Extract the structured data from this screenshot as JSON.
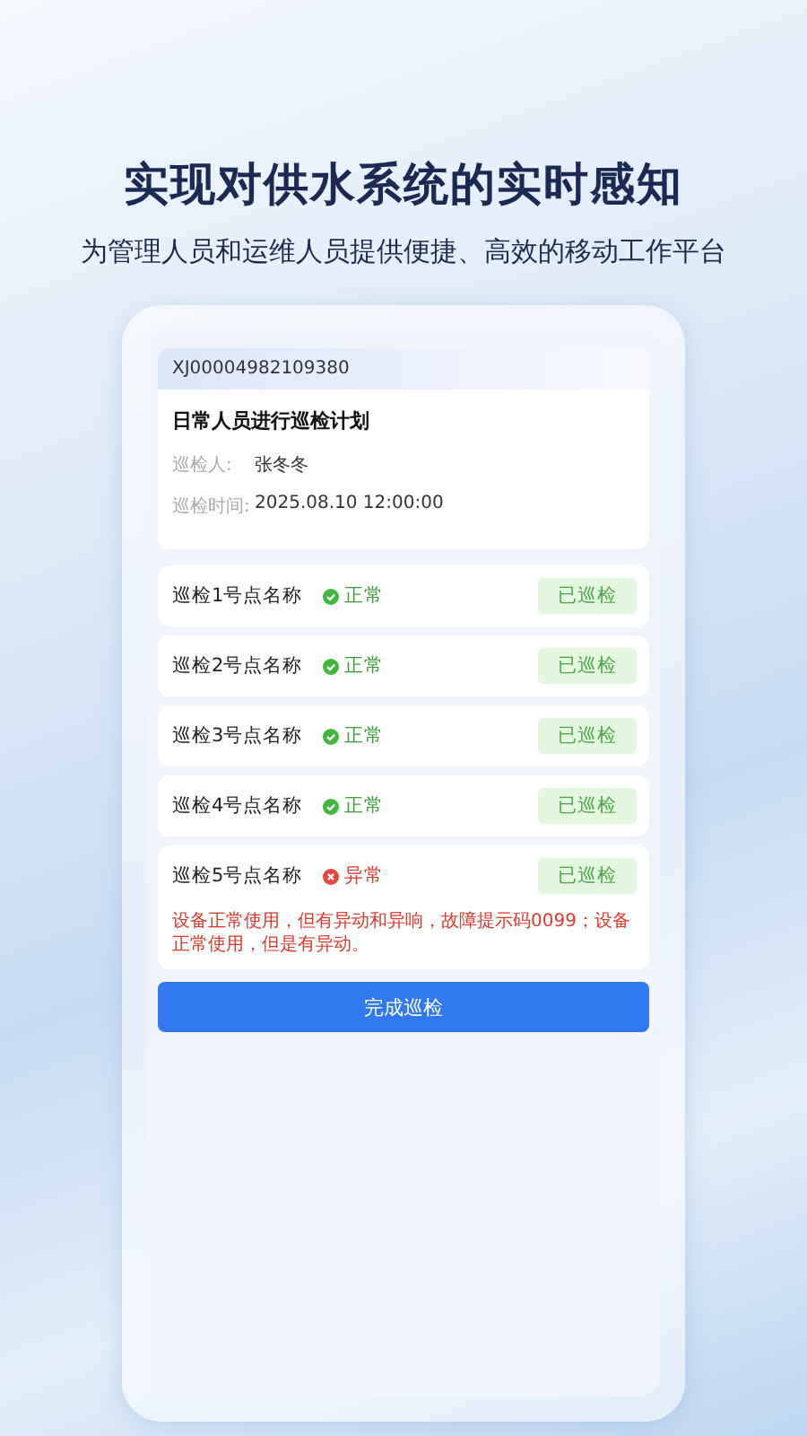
{
  "headline": "实现对供水系统的实时感知",
  "subtitle": "为管理人员和运维人员提供便捷、高效的移动工作平台",
  "task": {
    "code": "XJ00004982109380",
    "title": "日常人员进行巡检计划",
    "fields": [
      {
        "label": "巡检人:",
        "value": "张冬冬"
      },
      {
        "label": "巡检时间:",
        "value": "2025.08.10 12:00:00"
      }
    ]
  },
  "points": [
    {
      "name": "巡检1号点名称",
      "status": "正常",
      "kind": "normal",
      "action": "已巡检"
    },
    {
      "name": "巡检2号点名称",
      "status": "正常",
      "kind": "normal",
      "action": "已巡检"
    },
    {
      "name": "巡检3号点名称",
      "status": "正常",
      "kind": "normal",
      "action": "已巡检"
    },
    {
      "name": "巡检4号点名称",
      "status": "正常",
      "kind": "normal",
      "action": "已巡检"
    },
    {
      "name": "巡检5号点名称",
      "status": "异常",
      "kind": "abnormal",
      "action": "已巡检",
      "note": "设备正常使用，但有异动和异响，故障提示码0099；设备正常使用，但是有异动。"
    }
  ],
  "submit": "完成巡检"
}
